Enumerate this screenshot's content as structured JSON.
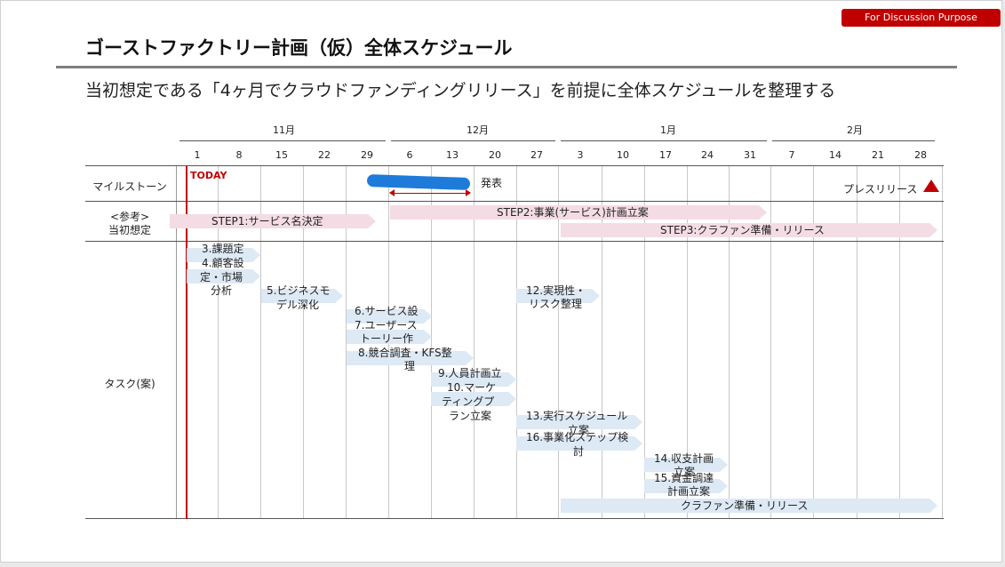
{
  "badge": "For Discussion Purpose",
  "title": "ゴーストファクトリー計画（仮）全体スケジュール",
  "subtitle": "当初想定である「4ヶ月でクラウドファンディングリリース」を前提に全体スケジュールを整理する",
  "months": [
    "11月",
    "12月",
    "1月",
    "2月"
  ],
  "dates": [
    "1",
    "8",
    "15",
    "22",
    "29",
    "6",
    "13",
    "20",
    "27",
    "3",
    "10",
    "17",
    "24",
    "31",
    "7",
    "14",
    "21",
    "28"
  ],
  "today": "TODAY",
  "rows": {
    "milestone": "マイルストーン",
    "reference": [
      "<参考>",
      "当初想定"
    ],
    "tasks": "タスク(案)"
  },
  "milestones": {
    "announce": "発表",
    "press": "プレスリリース"
  },
  "steps": [
    "STEP1:サービス名決定",
    "STEP2:事業(サービス)計画立案",
    "STEP3:クラファン準備・リリース"
  ],
  "tasks": [
    "3.課題定",
    "4.顧客設",
    "定・市場",
    "分析",
    "5.ビジネスモ",
    "デル深化",
    "6.サービス設",
    "7.ユーザース",
    "トーリー作",
    "8.競合調査・KFS整",
    "理",
    "9.人員計画立",
    "10.マーケ",
    "ティングプ",
    "ラン立案",
    "12.実現性・",
    "リスク整理",
    "13.実行スケジュール",
    "立案",
    "16.事業化ステップ検",
    "討",
    "14.収支計画",
    "立案",
    "15.資金調達",
    "計画立案",
    "クラファン準備・リリース"
  ],
  "colors": {
    "accent": "#c00000",
    "step_arrow": "#f4dce4",
    "task_arrow": "#dde9f5"
  }
}
